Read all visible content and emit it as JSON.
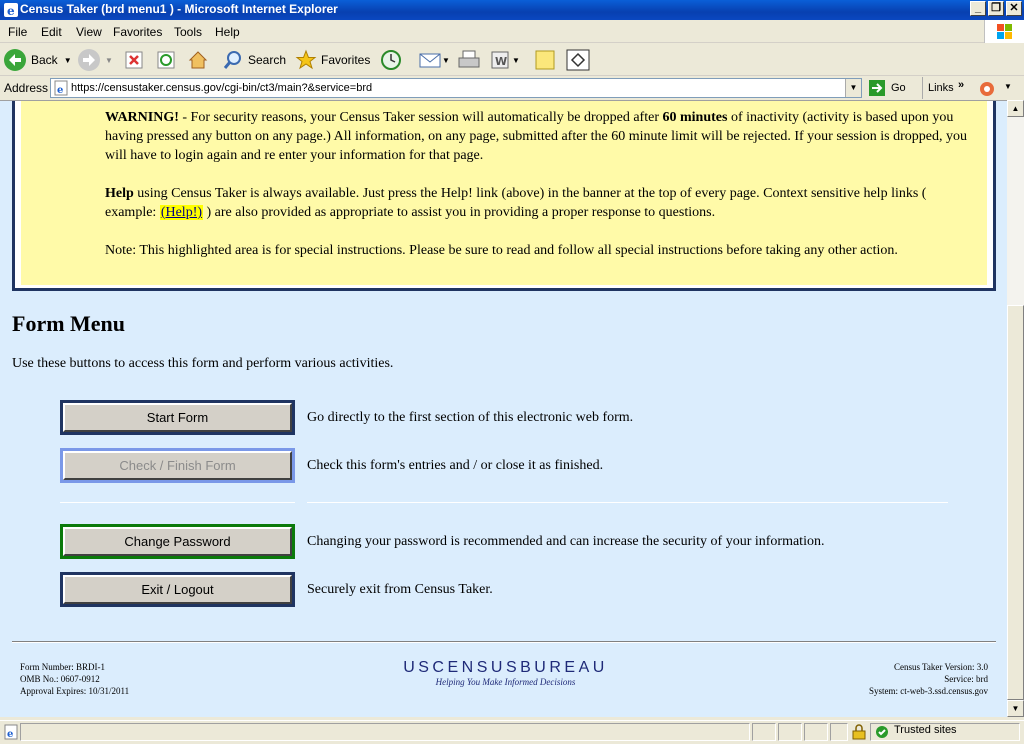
{
  "window": {
    "title": "Census Taker (brd menu1 ) - Microsoft Internet Explorer"
  },
  "menubar": [
    "File",
    "Edit",
    "View",
    "Favorites",
    "Tools",
    "Help"
  ],
  "toolbar": {
    "back": "Back",
    "search": "Search",
    "favorites": "Favorites"
  },
  "address": {
    "label": "Address",
    "url": "https://censustaker.census.gov/cgi-bin/ct3/main?&service=brd",
    "go": "Go",
    "links": "Links"
  },
  "notice": {
    "warning_label": "WARNING!",
    "warning_text_1": " - For security reasons, your Census Taker session will automatically be dropped after ",
    "warning_bold": "60 minutes",
    "warning_text_2": " of inactivity (activity is based upon you having pressed any button on any page.) All information, on any page, submitted after the 60 minute limit will be rejected. If your session is dropped, you will have to login again and re enter your information for that page.",
    "help_label": "Help",
    "help_text_1": " using Census Taker is always available. Just press the Help! link (above) in the banner at the top of every page. Context sensitive help links ( example: ",
    "help_link": "(Help!)",
    "help_text_2": " ) are also provided as appropriate to assist you in providing a proper response to questions.",
    "note": "Note: This highlighted area is for special instructions. Please be sure to read and follow all special instructions before taking any other action."
  },
  "form_menu": {
    "heading": "Form Menu",
    "intro": "Use these buttons to access this form and perform various activities.",
    "buttons": [
      {
        "label": "Start Form",
        "desc": "Go directly to the first section of this electronic web form.",
        "border": "#1f3461",
        "disabled": false
      },
      {
        "label": "Check / Finish Form",
        "desc": "Check this form's entries and / or close it as finished.",
        "border": "#7a98e8",
        "disabled": true
      },
      {
        "label": "Change Password",
        "desc": "Changing your password is recommended and can increase the security of your information.",
        "border": "#0b7a0b",
        "disabled": false
      },
      {
        "label": "Exit / Logout",
        "desc": "Securely exit from Census Taker.",
        "border": "#1f3461",
        "disabled": false
      }
    ]
  },
  "footer": {
    "form_number": "Form Number: BRDI-1",
    "omb": "OMB No.: 0607-0912",
    "approval": "Approval Expires: 10/31/2011",
    "logo": "USCENSUSBUREAU",
    "tagline": "Helping You Make Informed Decisions",
    "version": "Census Taker Version: 3.0",
    "service": "Service: brd",
    "system": "System: ct-web-3.ssd.census.gov"
  },
  "status": {
    "zone": "Trusted sites"
  }
}
